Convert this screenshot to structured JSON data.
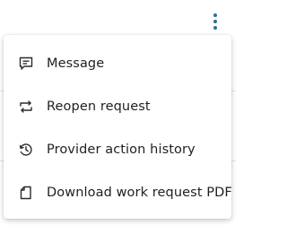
{
  "header": {
    "more_options_icon": "vertical-ellipsis-icon",
    "accent_color": "#2f6f8f"
  },
  "menu": {
    "items": [
      {
        "label": "Message",
        "icon": "message-icon"
      },
      {
        "label": "Reopen request",
        "icon": "repeat-icon"
      },
      {
        "label": "Provider action history",
        "icon": "history-icon"
      },
      {
        "label": "Download work request PDF",
        "icon": "document-icon"
      }
    ]
  }
}
